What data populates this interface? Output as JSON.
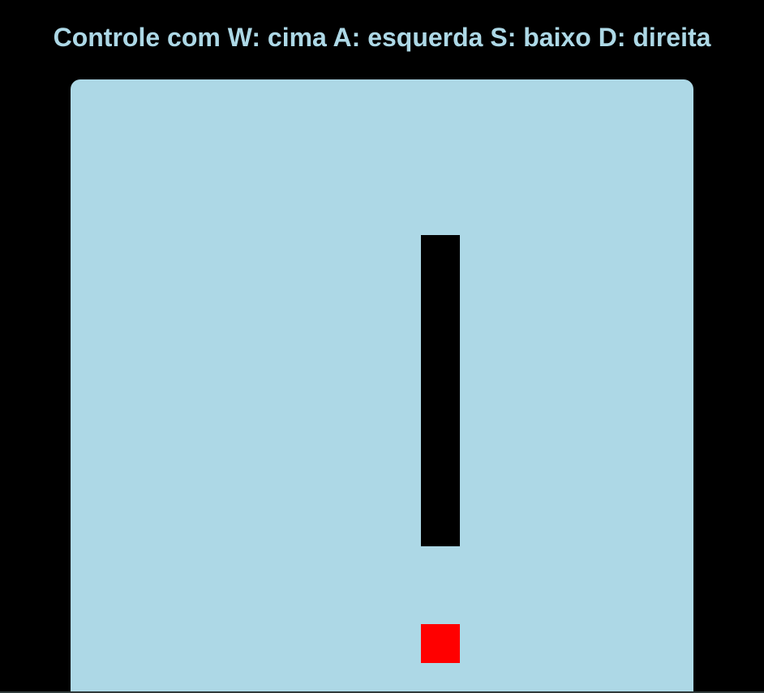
{
  "header": {
    "title": "Controle com W: cima A: esquerda S: baixo D: direita"
  },
  "game": {
    "grid_unit": "cell",
    "snake": [
      {
        "col": 9,
        "row": 4
      },
      {
        "col": 9,
        "row": 5
      },
      {
        "col": 9,
        "row": 6
      },
      {
        "col": 9,
        "row": 7
      },
      {
        "col": 9,
        "row": 8
      },
      {
        "col": 9,
        "row": 9
      },
      {
        "col": 9,
        "row": 10
      },
      {
        "col": 9,
        "row": 11
      }
    ],
    "food": {
      "col": 9,
      "row": 14
    },
    "colors": {
      "page_background": "#000000",
      "board_background": "#add8e6",
      "title_text": "#add8e6",
      "snake": "#000000",
      "food": "#ff0000"
    }
  }
}
